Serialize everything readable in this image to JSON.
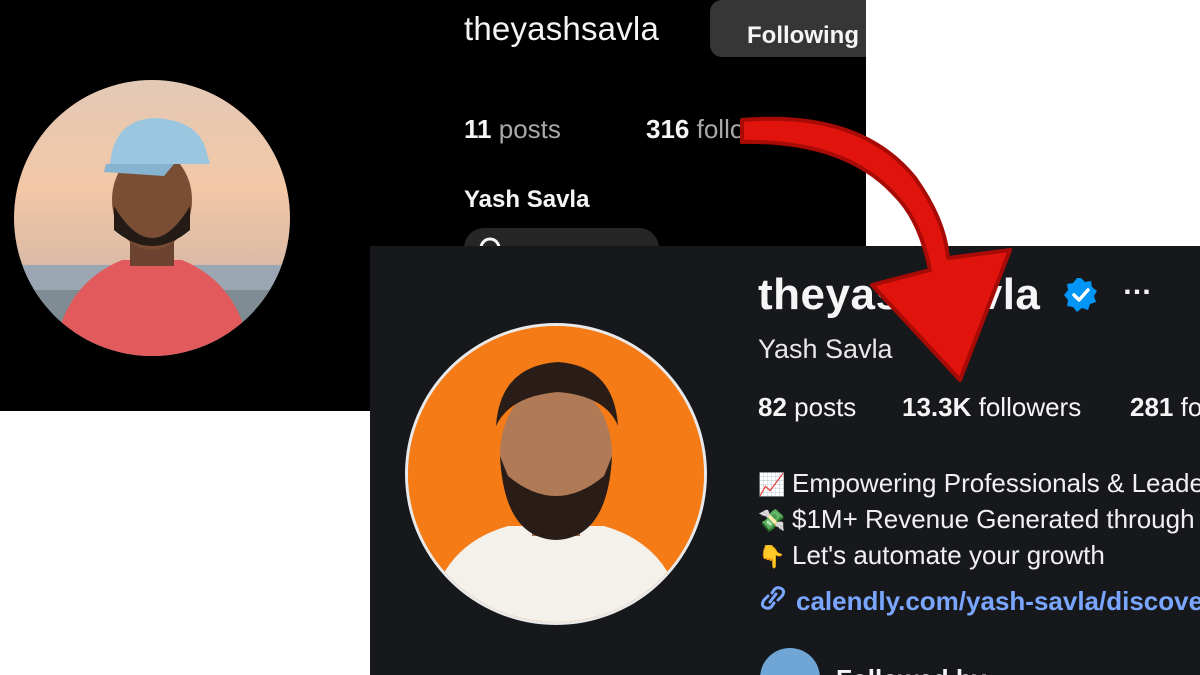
{
  "old_profile": {
    "username": "theyashsavla",
    "following_button": "Following",
    "posts_count": "11",
    "posts_label": "posts",
    "followers_count": "316",
    "followers_label": "followers",
    "name": "Yash Savla"
  },
  "new_profile": {
    "username": "theyashsavla",
    "verified_icon": "verified-badge-icon",
    "more_icon": "…",
    "full_name": "Yash Savla",
    "posts_count": "82",
    "posts_label": "posts",
    "followers_count": "13.3K",
    "followers_label": "followers",
    "following_count": "281",
    "following_label": "following",
    "bio": [
      {
        "emoji": "📈",
        "emoji_icon": "chart-increasing-icon",
        "text": "Empowering Professionals & Leaders"
      },
      {
        "emoji": "💸",
        "emoji_icon": "money-with-wings-icon",
        "text": "$1M+ Revenue Generated through"
      },
      {
        "emoji": "👇",
        "emoji_icon": "pointing-down-icon",
        "text": "Let's automate your growth"
      }
    ],
    "link": "calendly.com/yash-savla/discovery",
    "mutual_text": "Followed by"
  },
  "colors": {
    "old_bg": "#000000",
    "new_bg": "#16181c",
    "link_blue": "#7aa6ff",
    "verified_blue": "#0095f6",
    "arrow_red": "#e0140d",
    "avatar_orange": "#f57b17"
  }
}
